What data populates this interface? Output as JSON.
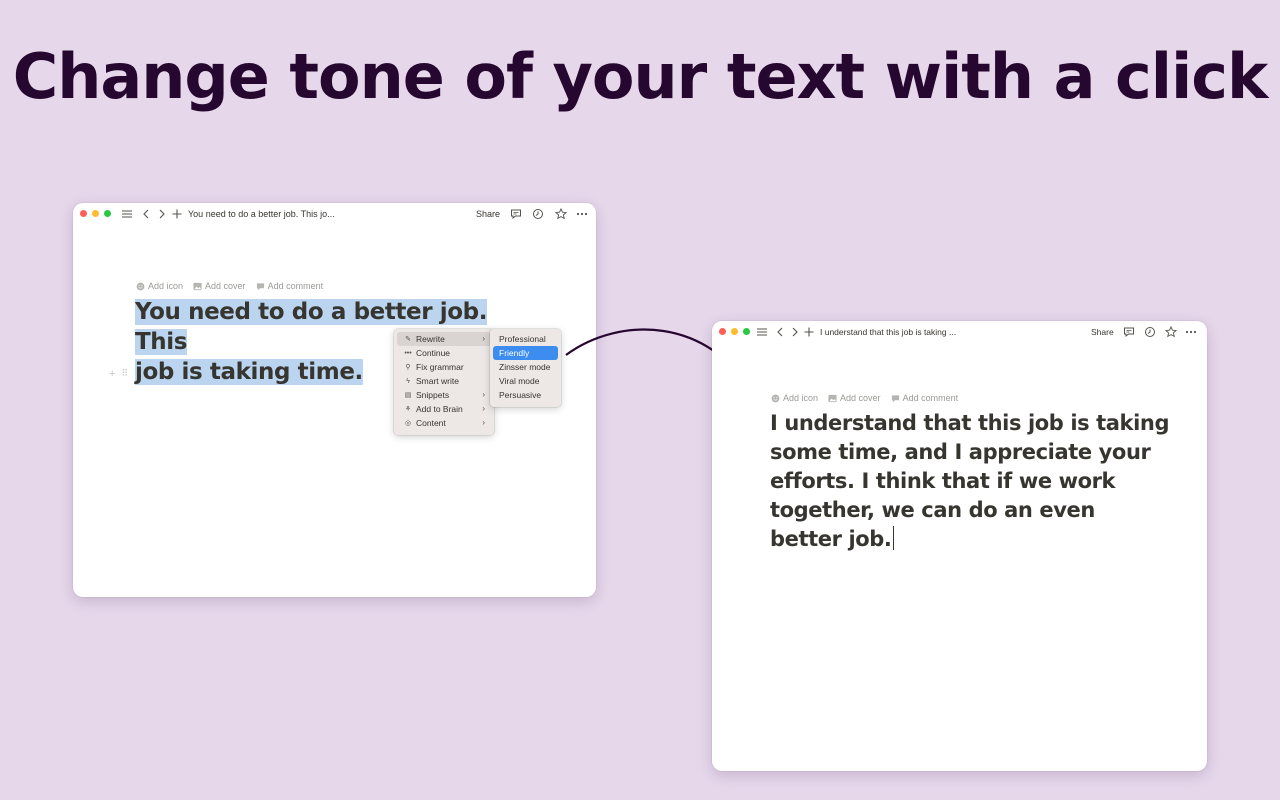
{
  "headline": "Change tone of your text with a click",
  "window_before": {
    "title": "You need to do a better job. This jo...",
    "share_label": "Share",
    "meta": {
      "add_icon": "Add icon",
      "add_cover": "Add cover",
      "add_comment": "Add comment"
    },
    "content_line1": "You need to do a better job. This",
    "content_line2": "job is taking time.",
    "menu": {
      "items": [
        {
          "label": "Rewrite",
          "icon": "pen-icon",
          "has_submenu": true,
          "active": true
        },
        {
          "label": "Continue",
          "icon": "dots-icon",
          "has_submenu": false
        },
        {
          "label": "Fix grammar",
          "icon": "magic-icon",
          "has_submenu": false
        },
        {
          "label": "Smart write",
          "icon": "bolt-icon",
          "has_submenu": false
        },
        {
          "label": "Snippets",
          "icon": "doc-icon",
          "has_submenu": true
        },
        {
          "label": "Add to Brain",
          "icon": "brain-icon",
          "has_submenu": true
        },
        {
          "label": "Content",
          "icon": "target-icon",
          "has_submenu": true
        }
      ],
      "submenu": [
        {
          "label": "Professional"
        },
        {
          "label": "Friendly",
          "selected": true
        },
        {
          "label": "Zinsser mode"
        },
        {
          "label": "Viral mode"
        },
        {
          "label": "Persuasive"
        }
      ]
    }
  },
  "window_after": {
    "title": "I understand that this job is taking ...",
    "share_label": "Share",
    "meta": {
      "add_icon": "Add icon",
      "add_cover": "Add cover",
      "add_comment": "Add comment"
    },
    "content": "I understand that this job is taking some time, and I appreciate your efforts. I think that if we work together, we can do an even better job."
  },
  "colors": {
    "background": "#e6d7eb",
    "headline": "#26072f",
    "selection": "#bbd5f0",
    "menu_highlight": "#3d8cf0"
  }
}
